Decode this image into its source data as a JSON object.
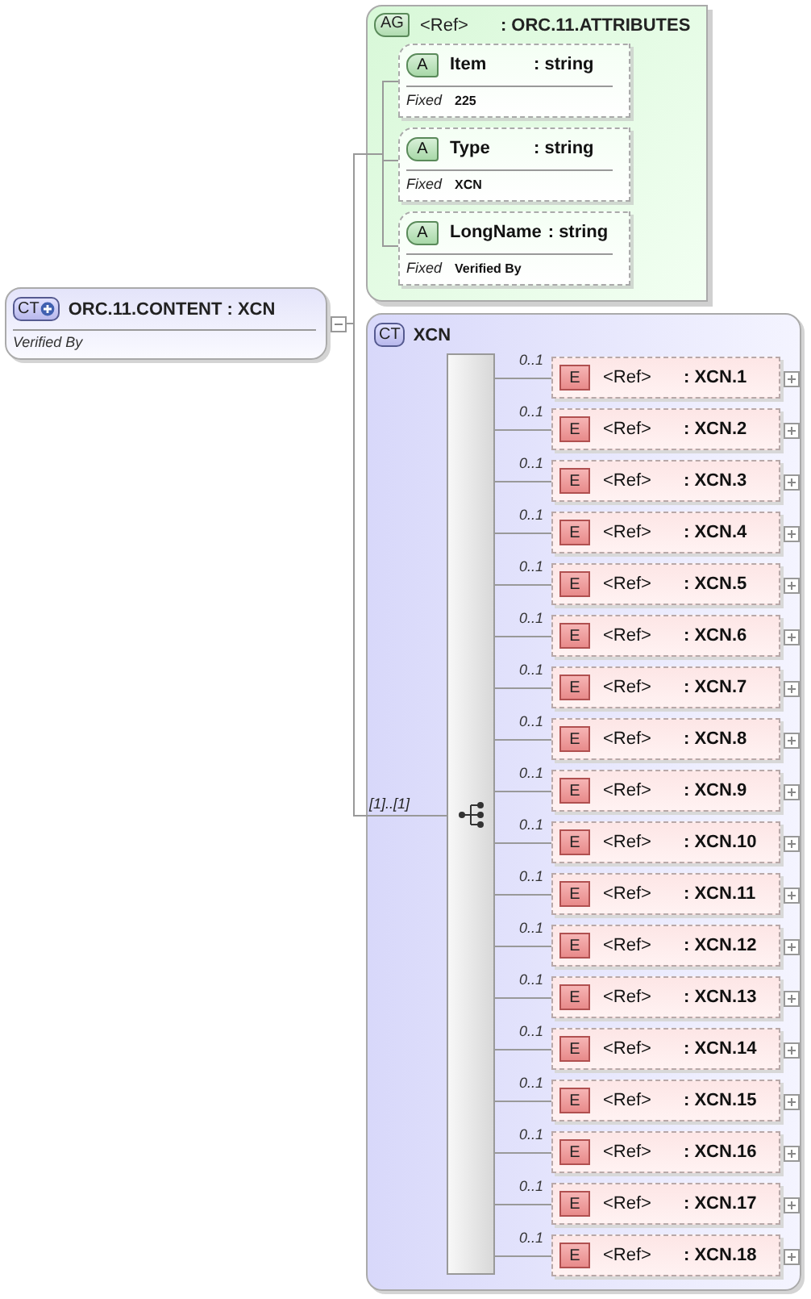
{
  "root": {
    "badge": "CT",
    "title": "ORC.11.CONTENT : XCN",
    "documentation": "Verified By",
    "expanded": true
  },
  "attribute_group": {
    "badge": "AG",
    "ref": "<Ref>",
    "type": ": ORC.11.ATTRIBUTES",
    "attributes": [
      {
        "badge": "A",
        "name": "Item",
        "type": ": string",
        "fixed_label": "Fixed",
        "fixed_value": "225"
      },
      {
        "badge": "A",
        "name": "Type",
        "type": ": string",
        "fixed_label": "Fixed",
        "fixed_value": "XCN"
      },
      {
        "badge": "A",
        "name": "LongName",
        "type": ": string",
        "fixed_label": "Fixed",
        "fixed_value": "Verified By"
      }
    ]
  },
  "complex_type": {
    "badge": "CT",
    "name": "XCN",
    "occurrence": "[1]..[1]",
    "elements": [
      {
        "cardinality": "0..1",
        "badge": "E",
        "ref": "<Ref>",
        "type": ": XCN.1",
        "expanded": false
      },
      {
        "cardinality": "0..1",
        "badge": "E",
        "ref": "<Ref>",
        "type": ": XCN.2",
        "expanded": false
      },
      {
        "cardinality": "0..1",
        "badge": "E",
        "ref": "<Ref>",
        "type": ": XCN.3",
        "expanded": false
      },
      {
        "cardinality": "0..1",
        "badge": "E",
        "ref": "<Ref>",
        "type": ": XCN.4",
        "expanded": false
      },
      {
        "cardinality": "0..1",
        "badge": "E",
        "ref": "<Ref>",
        "type": ": XCN.5",
        "expanded": false
      },
      {
        "cardinality": "0..1",
        "badge": "E",
        "ref": "<Ref>",
        "type": ": XCN.6",
        "expanded": false
      },
      {
        "cardinality": "0..1",
        "badge": "E",
        "ref": "<Ref>",
        "type": ": XCN.7",
        "expanded": false
      },
      {
        "cardinality": "0..1",
        "badge": "E",
        "ref": "<Ref>",
        "type": ": XCN.8",
        "expanded": false
      },
      {
        "cardinality": "0..1",
        "badge": "E",
        "ref": "<Ref>",
        "type": ": XCN.9",
        "expanded": false
      },
      {
        "cardinality": "0..1",
        "badge": "E",
        "ref": "<Ref>",
        "type": ": XCN.10",
        "expanded": false
      },
      {
        "cardinality": "0..1",
        "badge": "E",
        "ref": "<Ref>",
        "type": ": XCN.11",
        "expanded": false
      },
      {
        "cardinality": "0..1",
        "badge": "E",
        "ref": "<Ref>",
        "type": ": XCN.12",
        "expanded": false
      },
      {
        "cardinality": "0..1",
        "badge": "E",
        "ref": "<Ref>",
        "type": ": XCN.13",
        "expanded": false
      },
      {
        "cardinality": "0..1",
        "badge": "E",
        "ref": "<Ref>",
        "type": ": XCN.14",
        "expanded": false
      },
      {
        "cardinality": "0..1",
        "badge": "E",
        "ref": "<Ref>",
        "type": ": XCN.15",
        "expanded": false
      },
      {
        "cardinality": "0..1",
        "badge": "E",
        "ref": "<Ref>",
        "type": ": XCN.16",
        "expanded": false
      },
      {
        "cardinality": "0..1",
        "badge": "E",
        "ref": "<Ref>",
        "type": ": XCN.17",
        "expanded": false
      },
      {
        "cardinality": "0..1",
        "badge": "E",
        "ref": "<Ref>",
        "type": ": XCN.18",
        "expanded": false
      }
    ]
  }
}
